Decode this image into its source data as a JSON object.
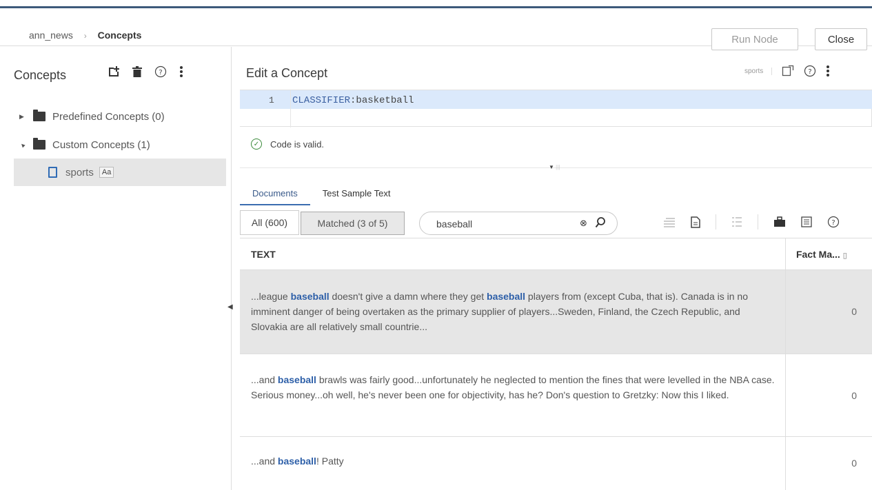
{
  "header": {
    "breadcrumb_root": "ann_news",
    "breadcrumb_current": "Concepts",
    "run_node_label": "Run Node",
    "close_label": "Close"
  },
  "left_panel": {
    "title": "Concepts",
    "tools": [
      "add-concept-icon",
      "delete-icon",
      "help-icon",
      "more-options-icon"
    ],
    "tree": [
      {
        "label": "Predefined Concepts (0)",
        "expanded": false
      },
      {
        "label": "Custom Concepts (1)",
        "expanded": true,
        "children": [
          {
            "label": "sports",
            "badge": "Aa"
          }
        ]
      }
    ]
  },
  "editor": {
    "title": "Edit a Concept",
    "concept_name": "sports",
    "line_number": "1",
    "code_keyword": "CLASSIFIER",
    "code_rest": ":basketball",
    "status": "Code is valid."
  },
  "tabs": [
    {
      "label": "Documents",
      "active": true
    },
    {
      "label": "Test Sample Text",
      "active": false
    }
  ],
  "filter": {
    "all_label": "All (600)",
    "matched_label": "Matched (3 of 5)",
    "search_value": "baseball"
  },
  "table": {
    "col_text": "TEXT",
    "col_fact": "Fact Ma...",
    "rows": [
      {
        "parts": [
          "...league ",
          "baseball",
          " doesn't give a damn where they get ",
          "baseball",
          " players from (except Cuba, that is). Canada is in no imminent danger of being overtaken as the primary supplier of players...Sweden, Finland, the Czech Republic, and Slovakia are all relatively small countrie..."
        ],
        "fact": "0",
        "selected": true
      },
      {
        "parts": [
          "...and ",
          "baseball",
          " brawls was fairly good...unfortunately he neglected to mention the fines that were levelled in the NBA case. Serious money...oh well, he's never been one for objectivity, has he? Don's question to Gretzky: Now this I liked."
        ],
        "fact": "0",
        "selected": false
      },
      {
        "parts": [
          "...and ",
          "baseball",
          "! Patty"
        ],
        "fact": "0",
        "selected": false
      }
    ]
  },
  "colors": {
    "accent": "#3d5a7a",
    "highlight": "#2d5fa8",
    "editor_line": "#dbe9fb"
  }
}
